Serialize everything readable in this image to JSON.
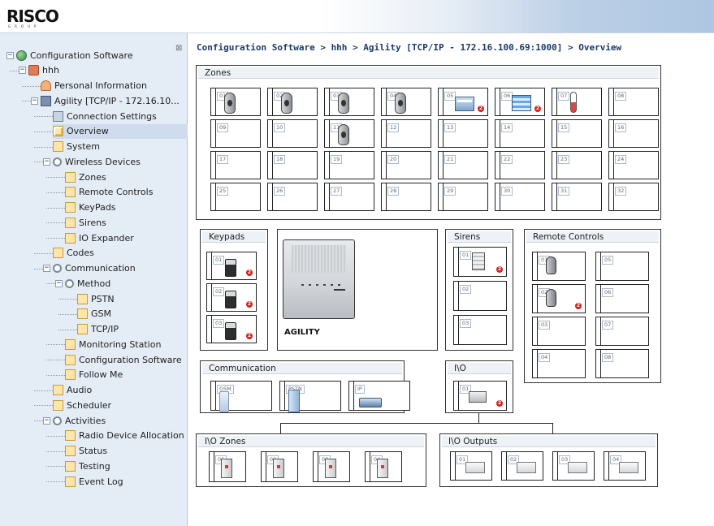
{
  "header": {
    "logo": "RISCO",
    "logo_sub": "GROUP"
  },
  "breadcrumb": "Configuration Software > hhh > Agility [TCP/IP - 172.16.100.69:1000] > Overview",
  "tree": {
    "collapse_glyph": "⊠",
    "items": [
      {
        "label": "Configuration Software",
        "indent": 0,
        "expander": "⊟",
        "icon": "globe-icon",
        "selected": false
      },
      {
        "label": "hhh",
        "indent": 1,
        "expander": "⊟",
        "icon": "network-icon",
        "selected": false
      },
      {
        "label": "Personal Information",
        "indent": 2,
        "expander": "",
        "icon": "person-icon",
        "selected": false
      },
      {
        "label": "Agility [TCP/IP - 172.16.10...",
        "indent": 2,
        "expander": "⊟",
        "icon": "device-icon",
        "selected": false
      },
      {
        "label": "Connection Settings",
        "indent": 3,
        "expander": "",
        "icon": "connection-icon",
        "selected": false
      },
      {
        "label": "Overview",
        "indent": 3,
        "expander": "",
        "icon": "overview-icon",
        "selected": true
      },
      {
        "label": "System",
        "indent": 3,
        "expander": "",
        "icon": "folder-icon",
        "selected": false
      },
      {
        "label": "Wireless Devices",
        "indent": 3,
        "expander": "⊟",
        "icon": "gear-icon",
        "selected": false
      },
      {
        "label": "Zones",
        "indent": 4,
        "expander": "",
        "icon": "folder-icon",
        "selected": false
      },
      {
        "label": "Remote Controls",
        "indent": 4,
        "expander": "",
        "icon": "folder-icon",
        "selected": false
      },
      {
        "label": "KeyPads",
        "indent": 4,
        "expander": "",
        "icon": "folder-icon",
        "selected": false
      },
      {
        "label": "Sirens",
        "indent": 4,
        "expander": "",
        "icon": "folder-icon",
        "selected": false
      },
      {
        "label": "IO Expander",
        "indent": 4,
        "expander": "",
        "icon": "folder-icon",
        "selected": false
      },
      {
        "label": "Codes",
        "indent": 3,
        "expander": "",
        "icon": "folder-icon",
        "selected": false
      },
      {
        "label": "Communication",
        "indent": 3,
        "expander": "⊟",
        "icon": "gear-icon",
        "selected": false
      },
      {
        "label": "Method",
        "indent": 4,
        "expander": "⊟",
        "icon": "gear-icon",
        "selected": false
      },
      {
        "label": "PSTN",
        "indent": 5,
        "expander": "",
        "icon": "folder-icon",
        "selected": false
      },
      {
        "label": "GSM",
        "indent": 5,
        "expander": "",
        "icon": "folder-icon",
        "selected": false
      },
      {
        "label": "TCP/IP",
        "indent": 5,
        "expander": "",
        "icon": "folder-icon",
        "selected": false
      },
      {
        "label": "Monitoring Station",
        "indent": 4,
        "expander": "",
        "icon": "folder-icon",
        "selected": false
      },
      {
        "label": "Configuration Software",
        "indent": 4,
        "expander": "",
        "icon": "folder-icon",
        "selected": false
      },
      {
        "label": "Follow Me",
        "indent": 4,
        "expander": "",
        "icon": "folder-icon",
        "selected": false
      },
      {
        "label": "Audio",
        "indent": 3,
        "expander": "",
        "icon": "folder-icon",
        "selected": false
      },
      {
        "label": "Scheduler",
        "indent": 3,
        "expander": "",
        "icon": "folder-icon",
        "selected": false
      },
      {
        "label": "Activities",
        "indent": 3,
        "expander": "⊟",
        "icon": "gear-icon",
        "selected": false
      },
      {
        "label": "Radio Device Allocation",
        "indent": 4,
        "expander": "",
        "icon": "folder-icon",
        "selected": false
      },
      {
        "label": "Status",
        "indent": 4,
        "expander": "",
        "icon": "folder-icon",
        "selected": false
      },
      {
        "label": "Testing",
        "indent": 4,
        "expander": "",
        "icon": "folder-icon",
        "selected": false
      },
      {
        "label": "Event Log",
        "indent": 4,
        "expander": "",
        "icon": "folder-icon",
        "selected": false
      }
    ]
  },
  "zones": {
    "title": "Zones",
    "slots": [
      {
        "num": "01",
        "device": "detector-icon"
      },
      {
        "num": "02",
        "device": "detector-icon"
      },
      {
        "num": "03",
        "device": "detector-icon"
      },
      {
        "num": "04",
        "device": "detector-icon"
      },
      {
        "num": "05",
        "device": "smoke-detector-icon",
        "badge": "2"
      },
      {
        "num": "06",
        "device": "flood-detector-icon",
        "badge": "2"
      },
      {
        "num": "07",
        "device": "thermometer-icon"
      },
      {
        "num": "08",
        "device": ""
      },
      {
        "num": "09",
        "device": ""
      },
      {
        "num": "10",
        "device": ""
      },
      {
        "num": "11",
        "device": "detector-icon"
      },
      {
        "num": "12",
        "device": ""
      },
      {
        "num": "13",
        "device": ""
      },
      {
        "num": "14",
        "device": ""
      },
      {
        "num": "15",
        "device": ""
      },
      {
        "num": "16",
        "device": ""
      },
      {
        "num": "17",
        "device": ""
      },
      {
        "num": "18",
        "device": ""
      },
      {
        "num": "19",
        "device": ""
      },
      {
        "num": "20",
        "device": ""
      },
      {
        "num": "21",
        "device": ""
      },
      {
        "num": "22",
        "device": ""
      },
      {
        "num": "23",
        "device": ""
      },
      {
        "num": "24",
        "device": ""
      },
      {
        "num": "25",
        "device": ""
      },
      {
        "num": "26",
        "device": ""
      },
      {
        "num": "27",
        "device": ""
      },
      {
        "num": "28",
        "device": ""
      },
      {
        "num": "29",
        "device": ""
      },
      {
        "num": "30",
        "device": ""
      },
      {
        "num": "31",
        "device": ""
      },
      {
        "num": "32",
        "device": ""
      }
    ]
  },
  "keypads": {
    "title": "Keypads",
    "slots": [
      {
        "num": "01",
        "device": "keypad-icon",
        "badge": "2"
      },
      {
        "num": "02",
        "device": "keypad-icon",
        "badge": "2"
      },
      {
        "num": "03",
        "device": "keypad-icon",
        "badge": "2"
      }
    ]
  },
  "agility_label": "AGILITY",
  "sirens": {
    "title": "Sirens",
    "slots": [
      {
        "num": "01",
        "device": "siren-icon",
        "badge": "2"
      },
      {
        "num": "02",
        "device": ""
      },
      {
        "num": "03",
        "device": ""
      }
    ]
  },
  "remote_controls": {
    "title": "Remote Controls",
    "slots": [
      {
        "num": "01",
        "device": "remote-icon"
      },
      {
        "num": "05",
        "device": ""
      },
      {
        "num": "02",
        "device": "remote-icon",
        "badge": "2"
      },
      {
        "num": "06",
        "device": ""
      },
      {
        "num": "03",
        "device": ""
      },
      {
        "num": "07",
        "device": ""
      },
      {
        "num": "04",
        "device": ""
      },
      {
        "num": "08",
        "device": ""
      }
    ]
  },
  "communication": {
    "title": "Communication",
    "slots": [
      {
        "num": "GSM",
        "device": "gsm-module-icon"
      },
      {
        "num": "PSTN",
        "device": "pstn-module-icon"
      },
      {
        "num": "IP",
        "device": "ip-module-icon"
      }
    ]
  },
  "io": {
    "title": "I\\O",
    "slots": [
      {
        "num": "01",
        "device": "io-expander-icon",
        "badge": "2"
      }
    ]
  },
  "io_zones": {
    "title": "I\\O Zones",
    "slots": [
      {
        "num": "01",
        "device": "io-zone-icon"
      },
      {
        "num": "02",
        "device": "io-zone-icon"
      },
      {
        "num": "03",
        "device": "io-zone-icon"
      },
      {
        "num": "04",
        "device": "io-zone-icon"
      }
    ]
  },
  "io_outputs": {
    "title": "I\\O Outputs",
    "slots": [
      {
        "num": "01",
        "device": "io-output-icon"
      },
      {
        "num": "02",
        "device": "io-output-icon"
      },
      {
        "num": "03",
        "device": "io-output-icon"
      },
      {
        "num": "04",
        "device": "io-output-icon"
      }
    ]
  }
}
